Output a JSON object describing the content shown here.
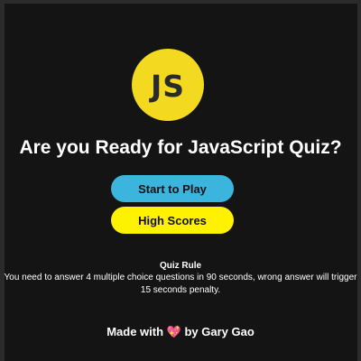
{
  "logo": {
    "text": "JS",
    "color": "#f3d91f"
  },
  "title": "Are you Ready for JavaScript Quiz?",
  "buttons": {
    "start_label": "Start to Play",
    "start_color": "#3bb4de",
    "scores_label": "High Scores",
    "scores_color": "#fff200"
  },
  "rules": {
    "heading": "Quiz Rule",
    "text": "You need to answer 4 multiple choice questions in 90 seconds, wrong answer will trigger 15 seconds penalty."
  },
  "footer": {
    "prefix": "Made with",
    "icon": "heart-icon",
    "heart_glyph": "💖",
    "suffix": "by Gary Gao"
  },
  "colors": {
    "background": "#141414",
    "text": "#ffffff"
  }
}
